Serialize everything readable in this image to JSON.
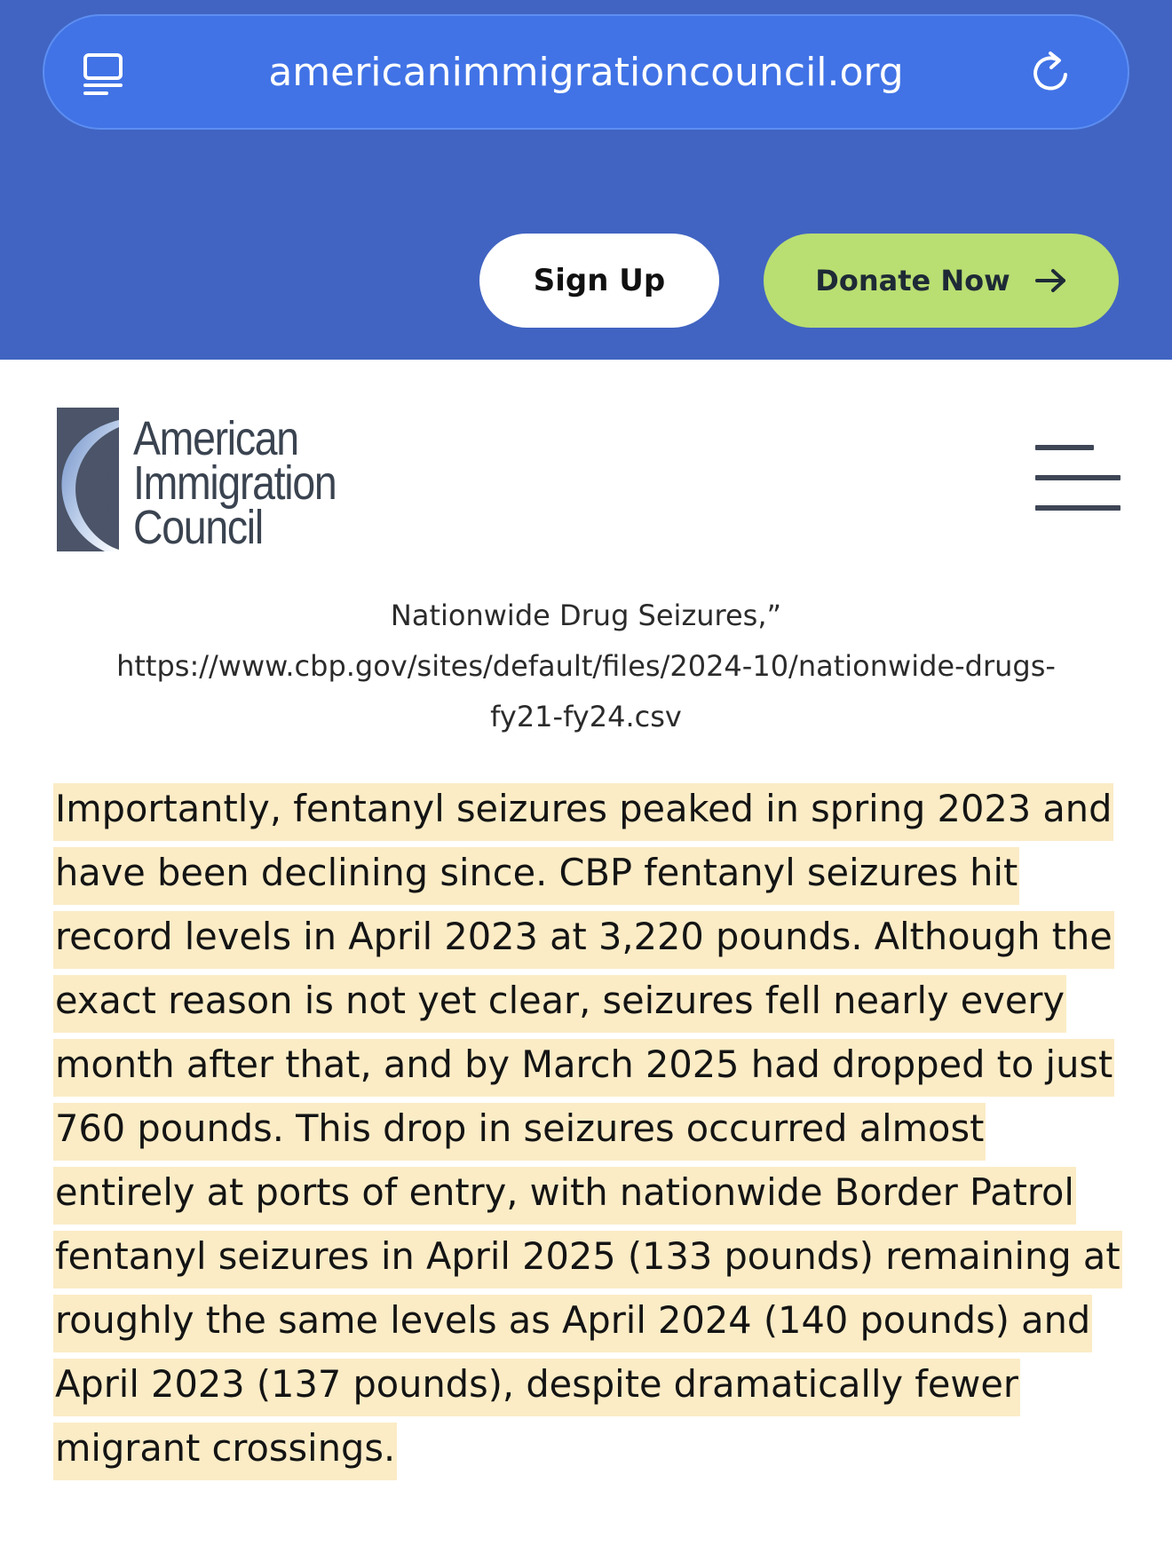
{
  "browser": {
    "url": "americanimmigrationcouncil.org"
  },
  "header_actions": {
    "signup_label": "Sign Up",
    "donate_label": "Donate Now"
  },
  "site": {
    "logo_lines": [
      "American",
      "Immigration",
      "Council"
    ]
  },
  "citation": {
    "line1": "Nationwide Drug Seizures,”",
    "line2": "https://www.cbp.gov/sites/default/files/2024-10/nationwide-drugs-",
    "line3": "fy21-fy24.csv"
  },
  "article": {
    "paragraph": "Importantly, fentanyl seizures peaked in spring 2023 and have been declining since. CBP fentanyl seizures hit record levels in April 2023 at 3,220 pounds. Although the exact reason is not yet clear, seizures fell nearly every month after that, and by March 2025 had dropped to just 760 pounds. This drop in seizures occurred almost entirely at ports of entry, with nationwide Border Patrol fentanyl seizures in April 2025 (133 pounds) remaining at roughly the same levels as April 2024 (140 pounds) and April 2023 (137 pounds), despite dramatically fewer migrant crossings."
  },
  "colors": {
    "browser_bar": "#4164c2",
    "url_pill": "#4173e6",
    "donate_button": "#b9de72",
    "highlight": "#fbecc6",
    "logo_text": "#3a4350"
  },
  "icons": {
    "reader": "reader-mode-icon",
    "reload": "reload-icon",
    "arrow": "arrow-right-icon",
    "menu": "hamburger-menu-icon"
  }
}
